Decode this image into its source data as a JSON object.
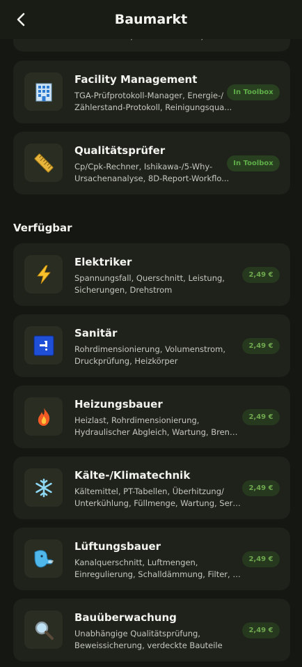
{
  "header": {
    "title": "Baumarkt",
    "back_icon": "back-chevron-icon"
  },
  "partial_card": {
    "desc": "EnEV-Rechner, Dämmstoffdicke, Heizlastberechnung"
  },
  "installed": [
    {
      "title": "Facility Management",
      "desc_line1": "TGA-Prüfprotokoll-Manager, Energie-/",
      "desc_line2": "Zählerstand-Protokoll, Reinigungsqua...",
      "badge": "In Toolbox",
      "icon": "office-building-icon"
    },
    {
      "title": "Qualitätsprüfer",
      "desc_line1": "Cp/Cpk-Rechner, Ishikawa-/5-Why-",
      "desc_line2": "Ursachenanalyse, 8D-Report-Workflo...",
      "badge": "In Toolbox",
      "icon": "ruler-icon"
    }
  ],
  "available_section": {
    "title": "Verfügbar"
  },
  "available": [
    {
      "title": "Elektriker",
      "desc_line1": "Spannungsfall, Querschnitt, Leistung,",
      "desc_line2": "Sicherungen, Drehstrom",
      "price": "2,49 €",
      "icon": "lightning-icon"
    },
    {
      "title": "Sanitär",
      "desc_line1": "Rohrdimensionierung, Volumenstrom,",
      "desc_line2": "Druckprüfung, Heizkörper",
      "price": "2,49 €",
      "icon": "water-tap-icon"
    },
    {
      "title": "Heizungsbauer",
      "desc_line1": "Heizlast, Rohrdimensionierung,",
      "desc_line2": "Hydraulischer Abgleich, Wartung, Brennw...",
      "price": "2,49 €",
      "icon": "fire-icon"
    },
    {
      "title": "Kälte-/Klimatechnik",
      "desc_line1": "Kältemittel, PT-Tabellen, Überhitzung/",
      "desc_line2": "Unterkühlung, Füllmenge, Wartung, Servi...",
      "price": "2,49 €",
      "icon": "snowflake-icon"
    },
    {
      "title": "Lüftungsbauer",
      "desc_line1": "Kanalquerschnitt, Luftmengen,",
      "desc_line2": "Einregulierung, Schalldämmung, Filter, Di...",
      "price": "2,49 €",
      "icon": "wind-face-icon"
    },
    {
      "title": "Bauüberwachung",
      "desc_line1": "Unabhängige Qualitätsprüfung,",
      "desc_line2": "Beweissicherung, verdeckte Bauteile",
      "price": "2,49 €",
      "icon": "magnifier-icon"
    }
  ]
}
